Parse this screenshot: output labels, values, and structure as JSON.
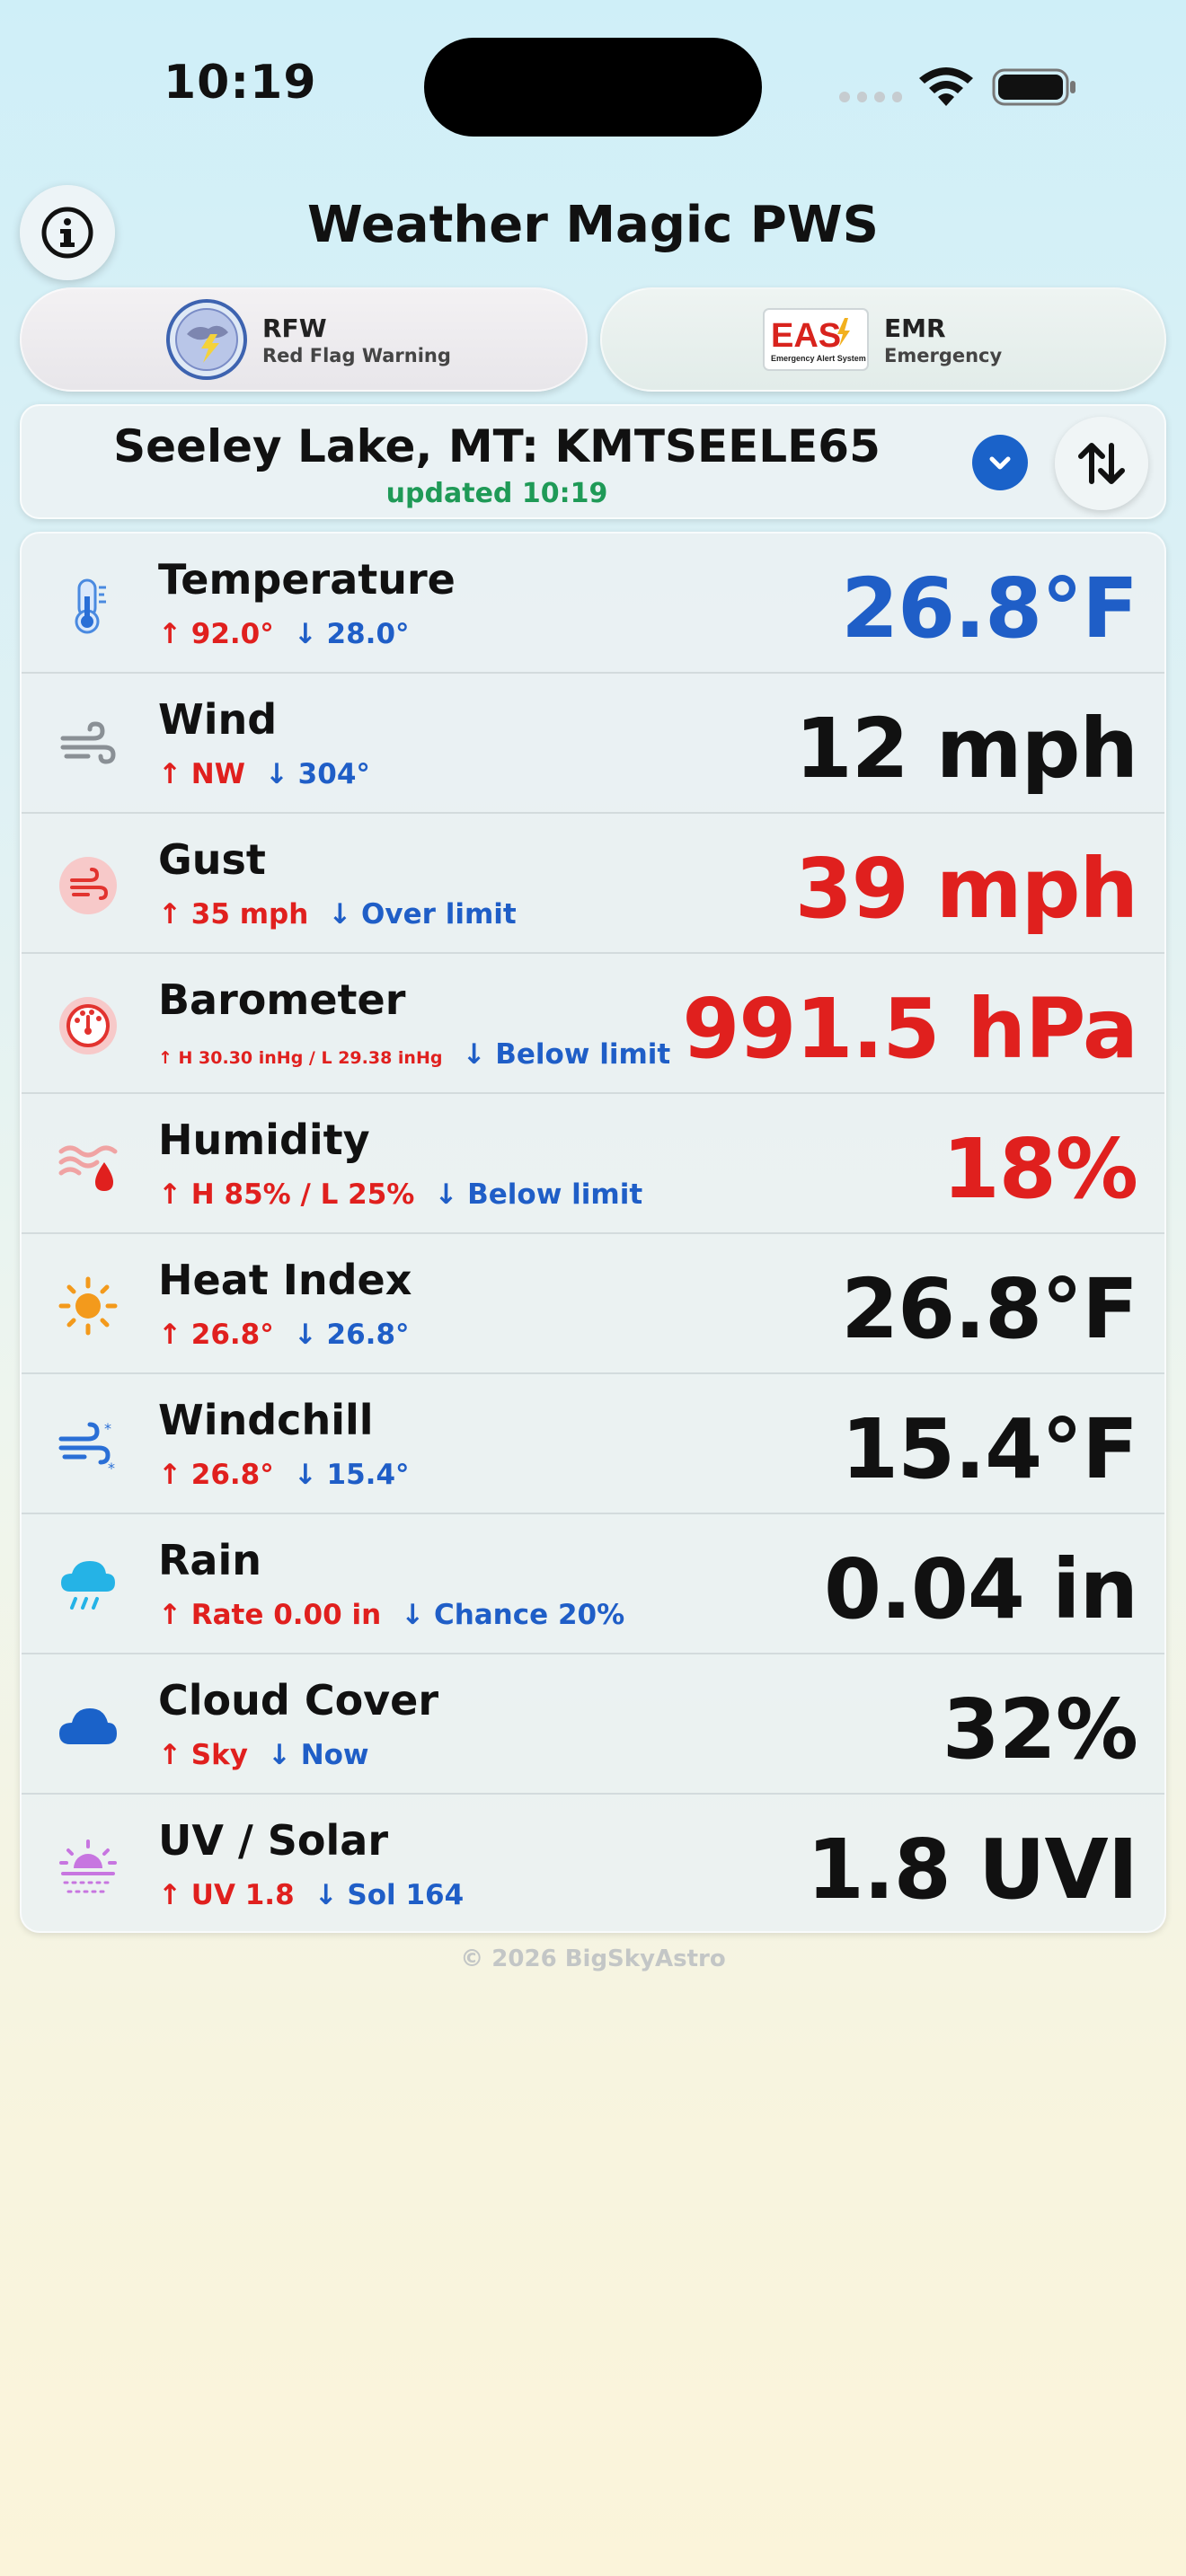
{
  "status_bar": {
    "time": "10:19"
  },
  "header": {
    "title": "Weather Magic PWS"
  },
  "alerts": [
    {
      "code": "RFW",
      "description": "Red Flag Warning",
      "icon": "red-flag-warning-logo"
    },
    {
      "code": "EMR",
      "description": "Emergency",
      "icon": "eas-emergency-alert-system-logo",
      "logo_text": "EAS",
      "logo_subtext": "Emergency Alert System"
    }
  ],
  "station": {
    "name": "Seeley Lake, MT: KMTSEELE65",
    "updated": "updated 10:19"
  },
  "colors": {
    "value_blue": "#1f5ec7",
    "value_red": "#e0201e",
    "updated_green": "#1f9a57",
    "accent_blue": "#1a62c9"
  },
  "metrics": [
    {
      "label": "Temperature",
      "value": "26.8°F",
      "value_color": "blue",
      "hi": "↑ 92.0°",
      "lo": "↓ 28.0°",
      "icon": "thermometer-icon"
    },
    {
      "label": "Wind",
      "value": "12 mph",
      "value_color": "black",
      "hi": "↑ NW",
      "lo": "↓ 304°",
      "icon": "wind-icon"
    },
    {
      "label": "Gust",
      "value": "39 mph",
      "value_color": "red",
      "hi": "↑ 35 mph",
      "lo": "↓ Over limit",
      "icon": "gust-icon"
    },
    {
      "label": "Barometer",
      "value": "991.5 hPa",
      "value_color": "red",
      "hi": "↑ H 30.30 inHg / L 29.38 inHg",
      "lo": "↓ Below limit",
      "icon": "barometer-icon"
    },
    {
      "label": "Humidity",
      "value": "18%",
      "value_color": "red",
      "hi": "↑ H 85% / L 25%",
      "lo": "↓ Below limit",
      "icon": "humidity-icon"
    },
    {
      "label": "Heat Index",
      "value": "26.8°F",
      "value_color": "black",
      "hi": "↑ 26.8°",
      "lo": "↓ 26.8°",
      "icon": "sun-icon"
    },
    {
      "label": "Windchill",
      "value": "15.4°F",
      "value_color": "black",
      "hi": "↑ 26.8°",
      "lo": "↓ 15.4°",
      "icon": "windchill-icon"
    },
    {
      "label": "Rain",
      "value": "0.04 in",
      "value_color": "black",
      "hi": "↑ Rate 0.00 in",
      "lo": "↓ Chance 20%",
      "icon": "rain-cloud-icon"
    },
    {
      "label": "Cloud Cover",
      "value": "32%",
      "value_color": "black",
      "hi": "↑ Sky",
      "lo": "↓ Now",
      "icon": "cloud-icon"
    },
    {
      "label": "UV / Solar",
      "value": "1.8 UVI",
      "value_color": "black",
      "hi": "↑ UV 1.8",
      "lo": "↓ Sol 164",
      "icon": "sunrise-uv-icon"
    }
  ],
  "footer": {
    "copyright": "© 2026 BigSkyAstro"
  }
}
